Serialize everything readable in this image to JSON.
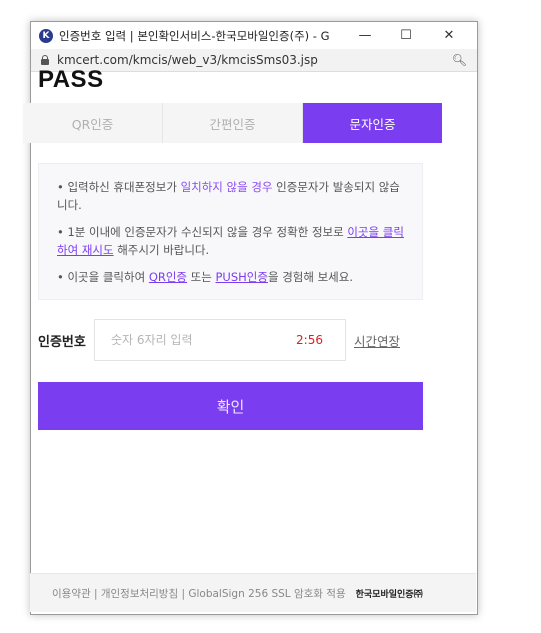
{
  "window": {
    "title": "인증번호 입력 | 본인확인서비스-한국모바일인증(주) - G...",
    "url": "kmcert.com/kmcis/web_v3/kmcisSms03.jsp",
    "minimize": "—",
    "maximize": "☐",
    "close": "✕"
  },
  "logo": "PASS",
  "tabs": [
    {
      "label": "QR인증",
      "active": false
    },
    {
      "label": "간편인증",
      "active": false
    },
    {
      "label": "문자인증",
      "active": true
    }
  ],
  "notice": {
    "item1_before": "• 입력하신 휴대폰정보가 ",
    "item1_highlight": "일치하지 않을 경우",
    "item1_after": " 인증문자가 발송되지 않습니다.",
    "item2_before": "• 1분 이내에 인증문자가 수신되지 않을 경우 정확한 정보로 ",
    "item2_link": "이곳을 클릭하여 재시도",
    "item2_after": " 해주시기 바랍니다.",
    "item3_before": "• 이곳을 클릭하여 ",
    "item3_link1": "QR인증",
    "item3_mid": " 또는 ",
    "item3_link2": "PUSH인증",
    "item3_after": "을 경험해 보세요."
  },
  "auth": {
    "label": "인증번호",
    "placeholder": "숫자 6자리 입력",
    "timer": "2:56",
    "extend": "시간연장"
  },
  "confirm_label": "확인",
  "footer": {
    "text": "이용약관 | 개인정보처리방침 | GlobalSign 256 SSL 암호화 적용",
    "brand": "한국모바일인증㈜"
  },
  "colors": {
    "accent": "#7b3df0",
    "timer": "#e02020"
  }
}
